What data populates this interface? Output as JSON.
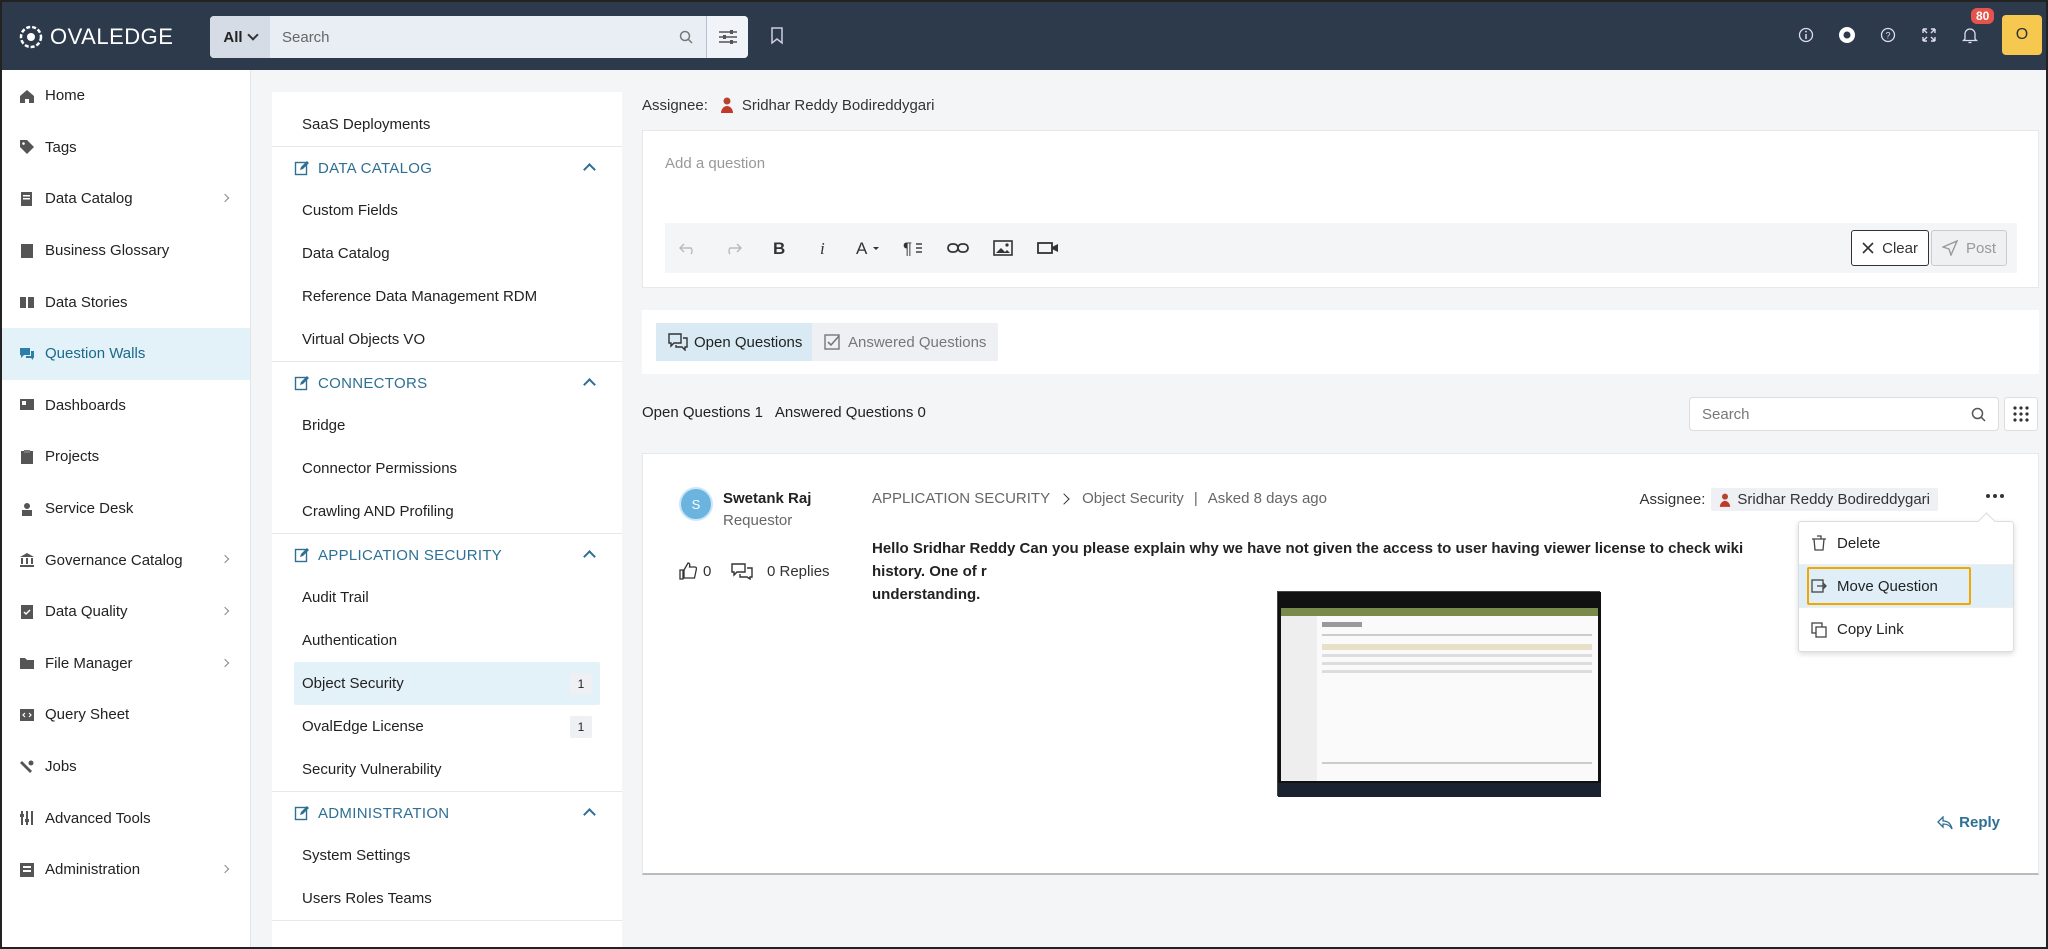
{
  "app": {
    "brand": "OVALEDGE"
  },
  "topbar": {
    "search_scope": "All",
    "search_placeholder": "Search",
    "notifications_count": "80",
    "user_initial": "O"
  },
  "leftnav": {
    "items": [
      {
        "label": "Home",
        "icon": "home-icon"
      },
      {
        "label": "Tags",
        "icon": "tag-icon"
      },
      {
        "label": "Data Catalog",
        "icon": "catalog-icon"
      },
      {
        "label": "Business Glossary",
        "icon": "book-icon"
      },
      {
        "label": "Data Stories",
        "icon": "stories-icon"
      },
      {
        "label": "Question Walls",
        "icon": "chat-icon"
      },
      {
        "label": "Dashboards",
        "icon": "dashboard-icon"
      },
      {
        "label": "Projects",
        "icon": "clipboard-icon"
      },
      {
        "label": "Service Desk",
        "icon": "service-icon"
      },
      {
        "label": "Governance Catalog",
        "icon": "bank-icon"
      },
      {
        "label": "Data Quality",
        "icon": "quality-icon"
      },
      {
        "label": "File Manager",
        "icon": "folder-icon"
      },
      {
        "label": "Query Sheet",
        "icon": "code-icon"
      },
      {
        "label": "Jobs",
        "icon": "jobs-icon"
      },
      {
        "label": "Advanced Tools",
        "icon": "tools-icon"
      },
      {
        "label": "Administration",
        "icon": "admin-icon"
      }
    ]
  },
  "categories": {
    "top_items": [
      "SaaS Deployments"
    ],
    "sections": [
      {
        "title": "DATA CATALOG",
        "items": [
          "Custom Fields",
          "Data Catalog",
          "Reference Data Management RDM",
          "Virtual Objects VO"
        ]
      },
      {
        "title": "CONNECTORS",
        "items": [
          "Bridge",
          "Connector Permissions",
          "Crawling AND Profiling"
        ]
      },
      {
        "title": "APPLICATION SECURITY",
        "items": [
          "Audit Trail",
          "Authentication",
          "Object Security",
          "OvalEdge License",
          "Security Vulnerability"
        ],
        "counts": {
          "object_security": "1",
          "ovaledge_license": "1"
        }
      },
      {
        "title": "ADMINISTRATION",
        "items": [
          "System Settings",
          "Users Roles Teams"
        ]
      }
    ]
  },
  "main": {
    "assignee_label": "Assignee:",
    "assignee_name": "Sridhar Reddy Bodireddygari",
    "editor_placeholder": "Add a question",
    "clear_label": "Clear",
    "post_label": "Post",
    "tab_open": "Open Questions",
    "tab_answered": "Answered Questions",
    "count_open": "Open Questions 1",
    "count_answered": "Answered Questions 0",
    "search_placeholder": "Search"
  },
  "question": {
    "avatar_initial": "S",
    "author": "Swetank Raj",
    "role": "Requestor",
    "likes": "0",
    "replies": "0 Replies",
    "category": "APPLICATION SECURITY",
    "subcategory": "Object Security",
    "separator": "|",
    "asked": "Asked 8 days ago",
    "assignee_label": "Assignee:",
    "assignee_name": "Sridhar Reddy Bodireddygari",
    "text": "Hello Sridhar Reddy Can you please explain why we have not given the access to user having viewer license to check wiki history. One of r",
    "text_line2": "understanding.",
    "reply_label": "Reply"
  },
  "context_menu": {
    "delete": "Delete",
    "move": "Move Question",
    "copy": "Copy Link"
  }
}
